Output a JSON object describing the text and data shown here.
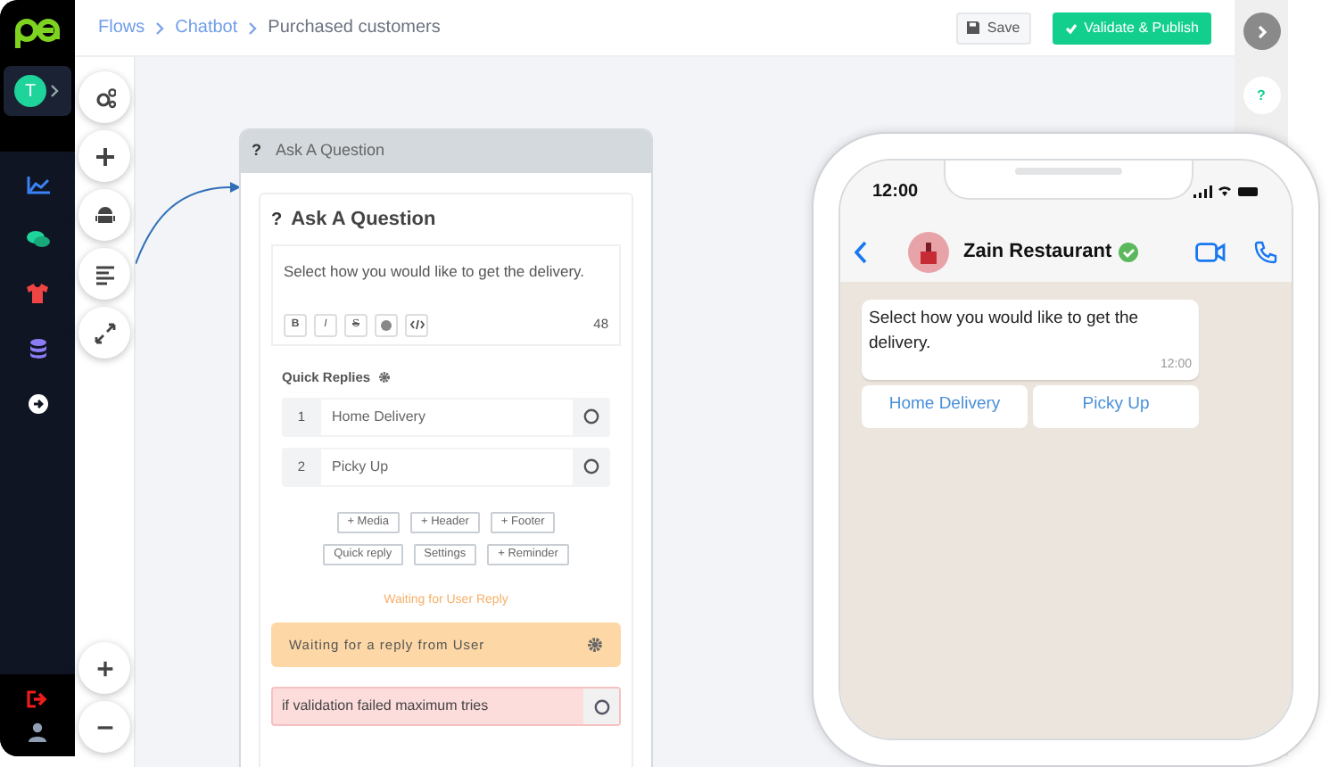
{
  "breadcrumb": [
    {
      "label": "Flows",
      "link": true
    },
    {
      "label": "Chatbot",
      "link": true
    },
    {
      "label": "Purchased customers",
      "link": false
    }
  ],
  "actions": [
    {
      "label": "Save",
      "kind": "secondary"
    },
    {
      "label": "Validate & Publish",
      "kind": "primary"
    }
  ],
  "sidebar": {
    "avatar": "T"
  },
  "right_rail": {
    "help": "?"
  },
  "node": {
    "header_icon": "?",
    "header": "Ask A Question",
    "title": "Ask A Question",
    "message": "Select how you would like to get the delivery.",
    "format_buttons": [
      "B",
      "I",
      "S"
    ],
    "char_count": "48",
    "quick_replies_label": "Quick Replies",
    "quick_replies": [
      {
        "number": "1",
        "label": "Home Delivery"
      },
      {
        "number": "2",
        "label": "Picky Up"
      }
    ],
    "add_buttons": [
      "+ Media",
      "+ Header",
      "+ Footer",
      "Quick reply",
      "Settings",
      "+ Reminder"
    ],
    "waiting_label": "Waiting for User Reply",
    "waiting_box": "Waiting for a reply from User",
    "validation": "if validation failed maximum tries"
  },
  "preview": {
    "time": "12:00",
    "contact": "Zain Restaurant",
    "verified": true,
    "message": "Select how you would like to get the delivery.",
    "message_time": "12:00",
    "buttons": [
      "Home Delivery",
      "Picky Up"
    ]
  }
}
